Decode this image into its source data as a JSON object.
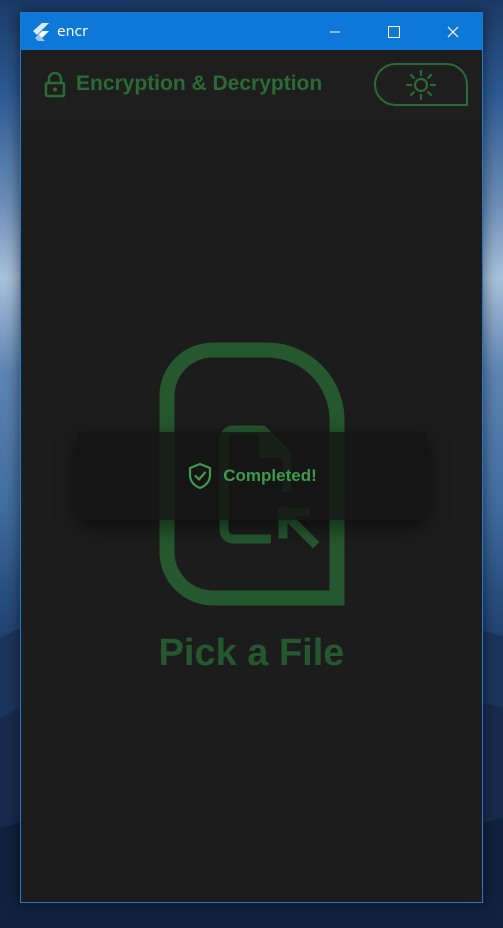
{
  "window": {
    "title": "encr"
  },
  "appbar": {
    "title": "Encryption & Decryption"
  },
  "main": {
    "pick_label": "Pick a File"
  },
  "toast": {
    "message": "Completed!"
  },
  "colors": {
    "accent": "#2b6a36",
    "toast_text": "#3f9a4d",
    "titlebar": "#0d78d7",
    "background": "#1c1c1c"
  },
  "icons": {
    "app": "flutter-logo-icon",
    "lock": "lock-icon",
    "theme": "sun-icon",
    "file": "file-pick-icon",
    "toast": "shield-check-icon"
  }
}
